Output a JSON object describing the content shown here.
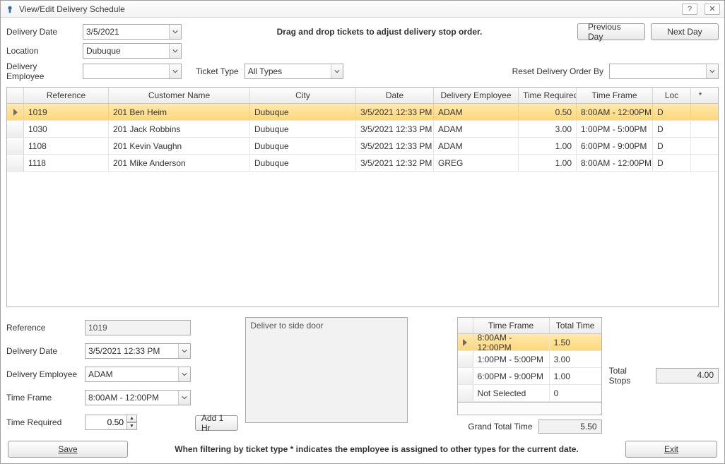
{
  "title": "View/Edit Delivery Schedule",
  "hint": "Drag and drop tickets to adjust delivery stop order.",
  "labels": {
    "delivery_date": "Delivery Date",
    "location": "Location",
    "delivery_employee": "Delivery Employee",
    "ticket_type": "Ticket Type",
    "reset_order": "Reset Delivery Order By",
    "reference": "Reference",
    "time_frame": "Time Frame",
    "time_required": "Time Required",
    "add_1hr": "Add 1 Hr",
    "grand_total": "Grand Total Time",
    "total_stops": "Total Stops",
    "footnote": "When filtering by ticket type * indicates the employee is assigned to other types for the current date."
  },
  "buttons": {
    "prev_day": "Previous Day",
    "next_day": "Next Day",
    "save": "Save",
    "exit": "Exit"
  },
  "filters": {
    "delivery_date": "3/5/2021",
    "location": "Dubuque",
    "delivery_employee": "",
    "ticket_type": "All Types",
    "reset_order": ""
  },
  "grid": {
    "headers": {
      "reference": "Reference",
      "customer": "Customer Name",
      "city": "City",
      "date": "Date",
      "employee": "Delivery Employee",
      "time_required": "Time Required",
      "time_frame": "Time Frame",
      "loc": "Loc",
      "star": "*"
    },
    "rows": [
      {
        "reference": "1019",
        "customer": "201 Ben Heim",
        "city": "Dubuque",
        "date": "3/5/2021 12:33 PM",
        "employee": "ADAM",
        "time_required": "0.50",
        "time_frame": "8:00AM - 12:00PM",
        "loc": "D",
        "star": "",
        "selected": true
      },
      {
        "reference": "1030",
        "customer": "201 Jack Robbins",
        "city": "Dubuque",
        "date": "3/5/2021 12:33 PM",
        "employee": "ADAM",
        "time_required": "3.00",
        "time_frame": "1:00PM - 5:00PM",
        "loc": "D",
        "star": ""
      },
      {
        "reference": "1108",
        "customer": "201 Kevin Vaughn",
        "city": "Dubuque",
        "date": "3/5/2021 12:33 PM",
        "employee": "ADAM",
        "time_required": "1.00",
        "time_frame": "6:00PM - 9:00PM",
        "loc": "D",
        "star": ""
      },
      {
        "reference": "1118",
        "customer": "201 Mike Anderson",
        "city": "Dubuque",
        "date": "3/5/2021 12:32 PM",
        "employee": "GREG",
        "time_required": "1.00",
        "time_frame": "8:00AM - 12:00PM",
        "loc": "D",
        "star": ""
      }
    ]
  },
  "detail": {
    "reference": "1019",
    "delivery_date": "3/5/2021 12:33 PM",
    "delivery_employee": "ADAM",
    "time_frame": "8:00AM - 12:00PM",
    "time_required": "0.50",
    "notes": "Deliver to side door"
  },
  "summary": {
    "headers": {
      "time_frame": "Time Frame",
      "total_time": "Total Time"
    },
    "rows": [
      {
        "time_frame": "8:00AM - 12:00PM",
        "total_time": "1.50",
        "selected": true
      },
      {
        "time_frame": "1:00PM - 5:00PM",
        "total_time": "3.00"
      },
      {
        "time_frame": "6:00PM - 9:00PM",
        "total_time": "1.00"
      },
      {
        "time_frame": "Not Selected",
        "total_time": "0"
      }
    ],
    "grand_total": "5.50"
  },
  "totals": {
    "stops": "4.00"
  }
}
